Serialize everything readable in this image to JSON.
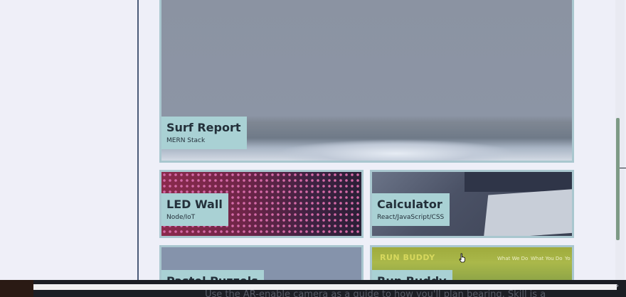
{
  "projects": [
    {
      "title": "Surf Report",
      "subtitle": "MERN Stack"
    },
    {
      "title": "LED Wall",
      "subtitle": "Node/IoT"
    },
    {
      "title": "Calculator",
      "subtitle": "React/JavaScript/CSS"
    },
    {
      "title": "Pastel Puzzels",
      "subtitle": ""
    },
    {
      "title": "Run Buddy",
      "subtitle": ""
    }
  ],
  "run_buddy_preview": {
    "logo": "RUN BUDDY",
    "nav": [
      "What We Do",
      "What You Do",
      "Yo"
    ]
  },
  "bottom_overlay_text": "Use the AR-enable camera as a guide to how you'll plan bearing. Skill is a",
  "colors": {
    "label_bg": "#a9d1d4",
    "tile_border": "#a9c7cf",
    "sidebar_divider": "#4b5a78"
  },
  "scroll": {
    "right_chevron": "›"
  }
}
